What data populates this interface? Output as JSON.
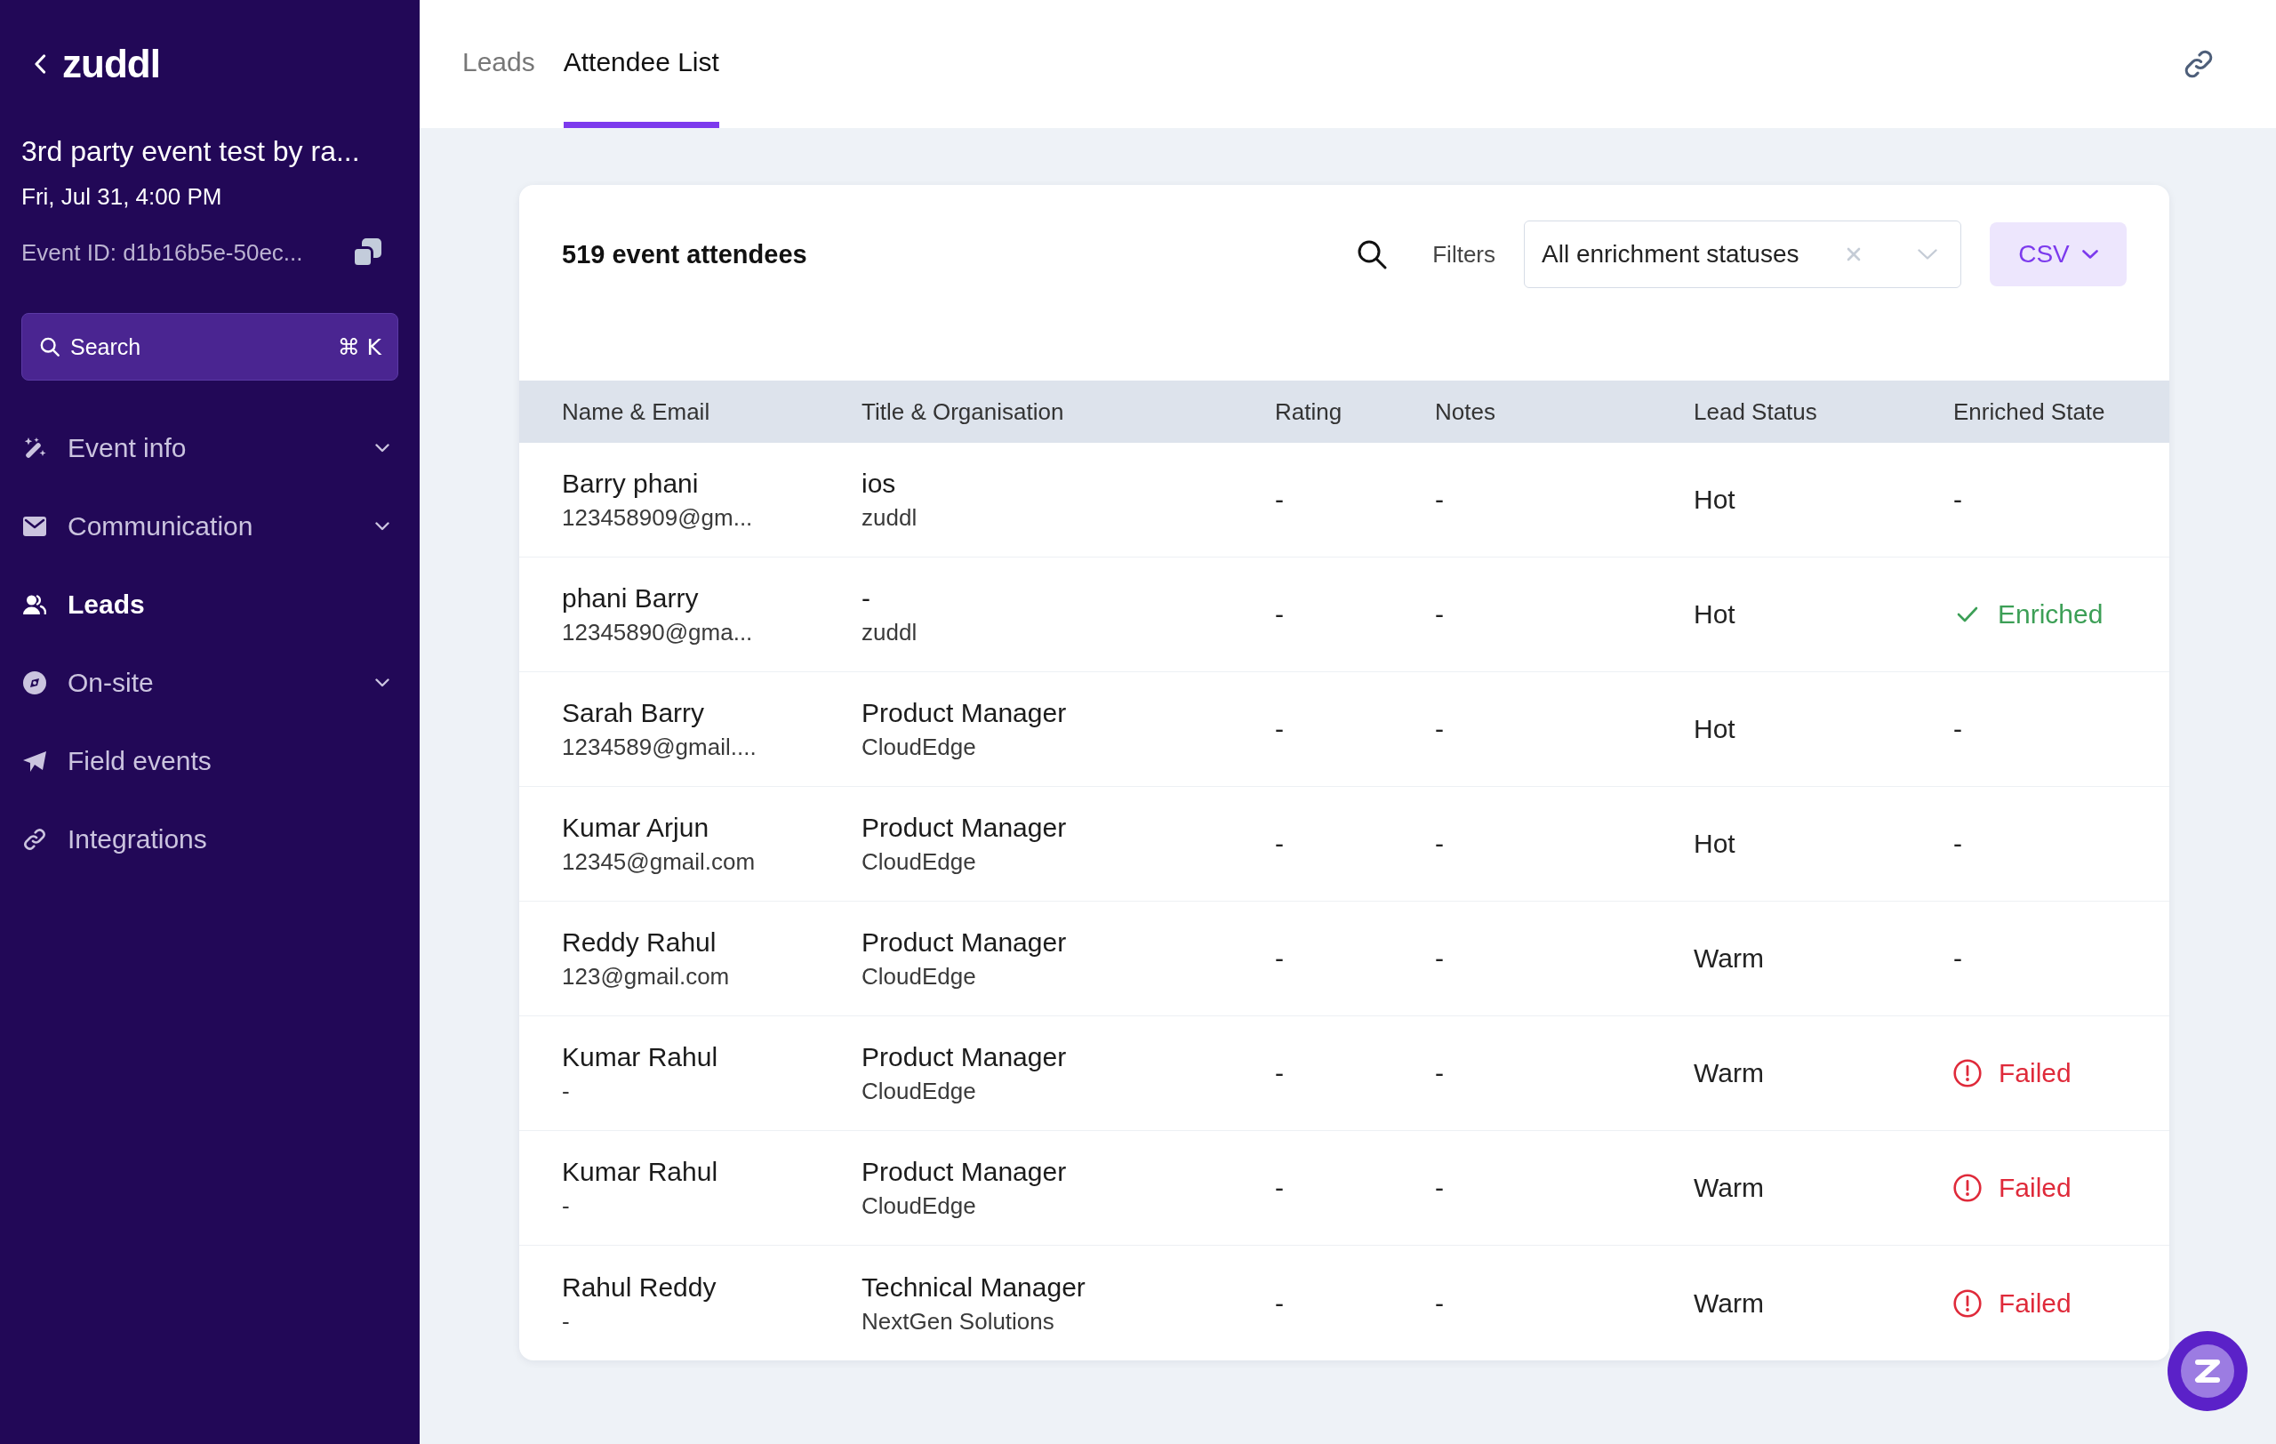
{
  "sidebar": {
    "logo": "zuddl",
    "event_title": "3rd party event test by ra...",
    "event_date": "Fri, Jul 31, 4:00 PM",
    "event_id": "Event ID: d1b16b5e-50ec...",
    "search": {
      "label": "Search",
      "shortcut": "⌘ K"
    },
    "nav": [
      {
        "label": "Event info",
        "expandable": true,
        "selected": false
      },
      {
        "label": "Communication",
        "expandable": true,
        "selected": false
      },
      {
        "label": "Leads",
        "expandable": false,
        "selected": true
      },
      {
        "label": "On-site",
        "expandable": true,
        "selected": false
      },
      {
        "label": "Field events",
        "expandable": false,
        "selected": false
      },
      {
        "label": "Integrations",
        "expandable": false,
        "selected": false
      }
    ]
  },
  "tabs": [
    {
      "label": "Leads",
      "selected": false
    },
    {
      "label": "Attendee List",
      "selected": true
    }
  ],
  "attendees": {
    "title": "519 event attendees",
    "filters_label": "Filters",
    "enrichment_filter": {
      "value": "All enrichment statuses"
    },
    "export_button": "CSV",
    "table": {
      "columns": [
        "Name & Email",
        "Title & Organisation",
        "Rating",
        "Notes",
        "Lead Status",
        "Enriched State"
      ],
      "rows": [
        {
          "name": "Barry phani",
          "email": "123458909@gm...",
          "title": "ios",
          "organisation": "zuddl",
          "rating": "-",
          "notes": "-",
          "lead_status": "Hot",
          "enriched_state": {
            "kind": "none",
            "label": "-"
          }
        },
        {
          "name": "phani Barry",
          "email": "12345890@gma...",
          "title": "-",
          "organisation": "zuddl",
          "rating": "-",
          "notes": "-",
          "lead_status": "Hot",
          "enriched_state": {
            "kind": "enriched",
            "label": "Enriched"
          }
        },
        {
          "name": "Sarah Barry",
          "email": "1234589@gmail....",
          "title": "Product Manager",
          "organisation": "CloudEdge",
          "rating": "-",
          "notes": "-",
          "lead_status": "Hot",
          "enriched_state": {
            "kind": "none",
            "label": "-"
          }
        },
        {
          "name": "Kumar Arjun",
          "email": "12345@gmail.com",
          "title": "Product Manager",
          "organisation": "CloudEdge",
          "rating": "-",
          "notes": "-",
          "lead_status": "Hot",
          "enriched_state": {
            "kind": "none",
            "label": "-"
          }
        },
        {
          "name": "Reddy Rahul",
          "email": "123@gmail.com",
          "title": "Product Manager",
          "organisation": "CloudEdge",
          "rating": "-",
          "notes": "-",
          "lead_status": "Warm",
          "enriched_state": {
            "kind": "none",
            "label": "-"
          }
        },
        {
          "name": "Kumar Rahul",
          "email": "-",
          "title": "Product Manager",
          "organisation": "CloudEdge",
          "rating": "-",
          "notes": "-",
          "lead_status": "Warm",
          "enriched_state": {
            "kind": "failed",
            "label": "Failed"
          }
        },
        {
          "name": "Kumar Rahul",
          "email": "-",
          "title": "Product Manager",
          "organisation": "CloudEdge",
          "rating": "-",
          "notes": "-",
          "lead_status": "Warm",
          "enriched_state": {
            "kind": "failed",
            "label": "Failed"
          }
        },
        {
          "name": "Rahul Reddy",
          "email": "-",
          "title": "Technical Manager",
          "organisation": "NextGen Solutions",
          "rating": "-",
          "notes": "-",
          "lead_status": "Warm",
          "enriched_state": {
            "kind": "failed",
            "label": "Failed"
          }
        }
      ]
    }
  }
}
